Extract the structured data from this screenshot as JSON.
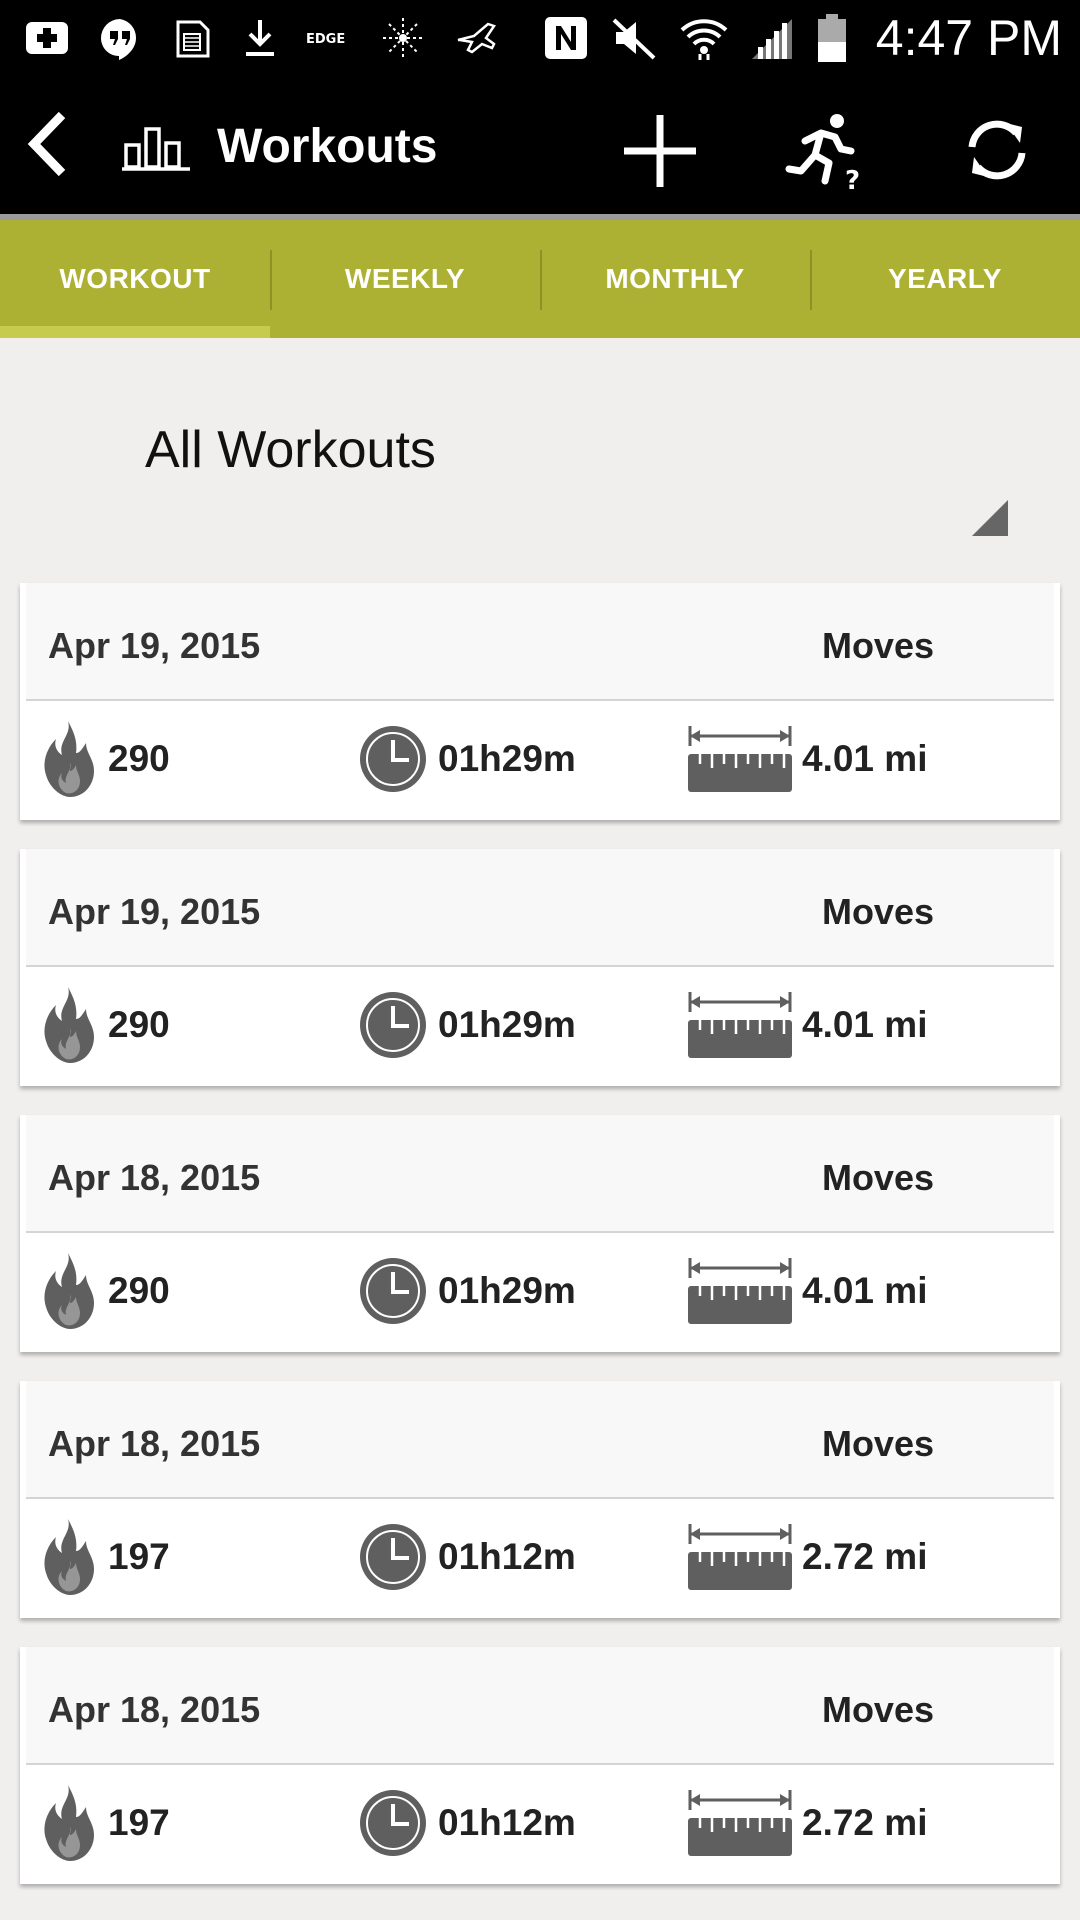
{
  "status_bar": {
    "time": "4:47 PM",
    "network_label": "EDGE"
  },
  "app_bar": {
    "title": "Workouts"
  },
  "tabs": [
    {
      "label": "WORKOUT",
      "active": true
    },
    {
      "label": "WEEKLY",
      "active": false
    },
    {
      "label": "MONTHLY",
      "active": false
    },
    {
      "label": "YEARLY",
      "active": false
    }
  ],
  "filter": {
    "selected": "All Workouts"
  },
  "workouts": [
    {
      "date": "Apr 19, 2015",
      "source": "Moves",
      "calories": "290",
      "duration": "01h29m",
      "distance": "4.01 mi"
    },
    {
      "date": "Apr 19, 2015",
      "source": "Moves",
      "calories": "290",
      "duration": "01h29m",
      "distance": "4.01 mi"
    },
    {
      "date": "Apr 18, 2015",
      "source": "Moves",
      "calories": "290",
      "duration": "01h29m",
      "distance": "4.01 mi"
    },
    {
      "date": "Apr 18, 2015",
      "source": "Moves",
      "calories": "197",
      "duration": "01h12m",
      "distance": "2.72 mi"
    },
    {
      "date": "Apr 18, 2015",
      "source": "Moves",
      "calories": "197",
      "duration": "01h12m",
      "distance": "2.72 mi"
    }
  ],
  "colors": {
    "tab_bar": "#acb133",
    "app_bar": "#000000",
    "background": "#f1eeee",
    "icon_gray": "#5f5f5f"
  }
}
